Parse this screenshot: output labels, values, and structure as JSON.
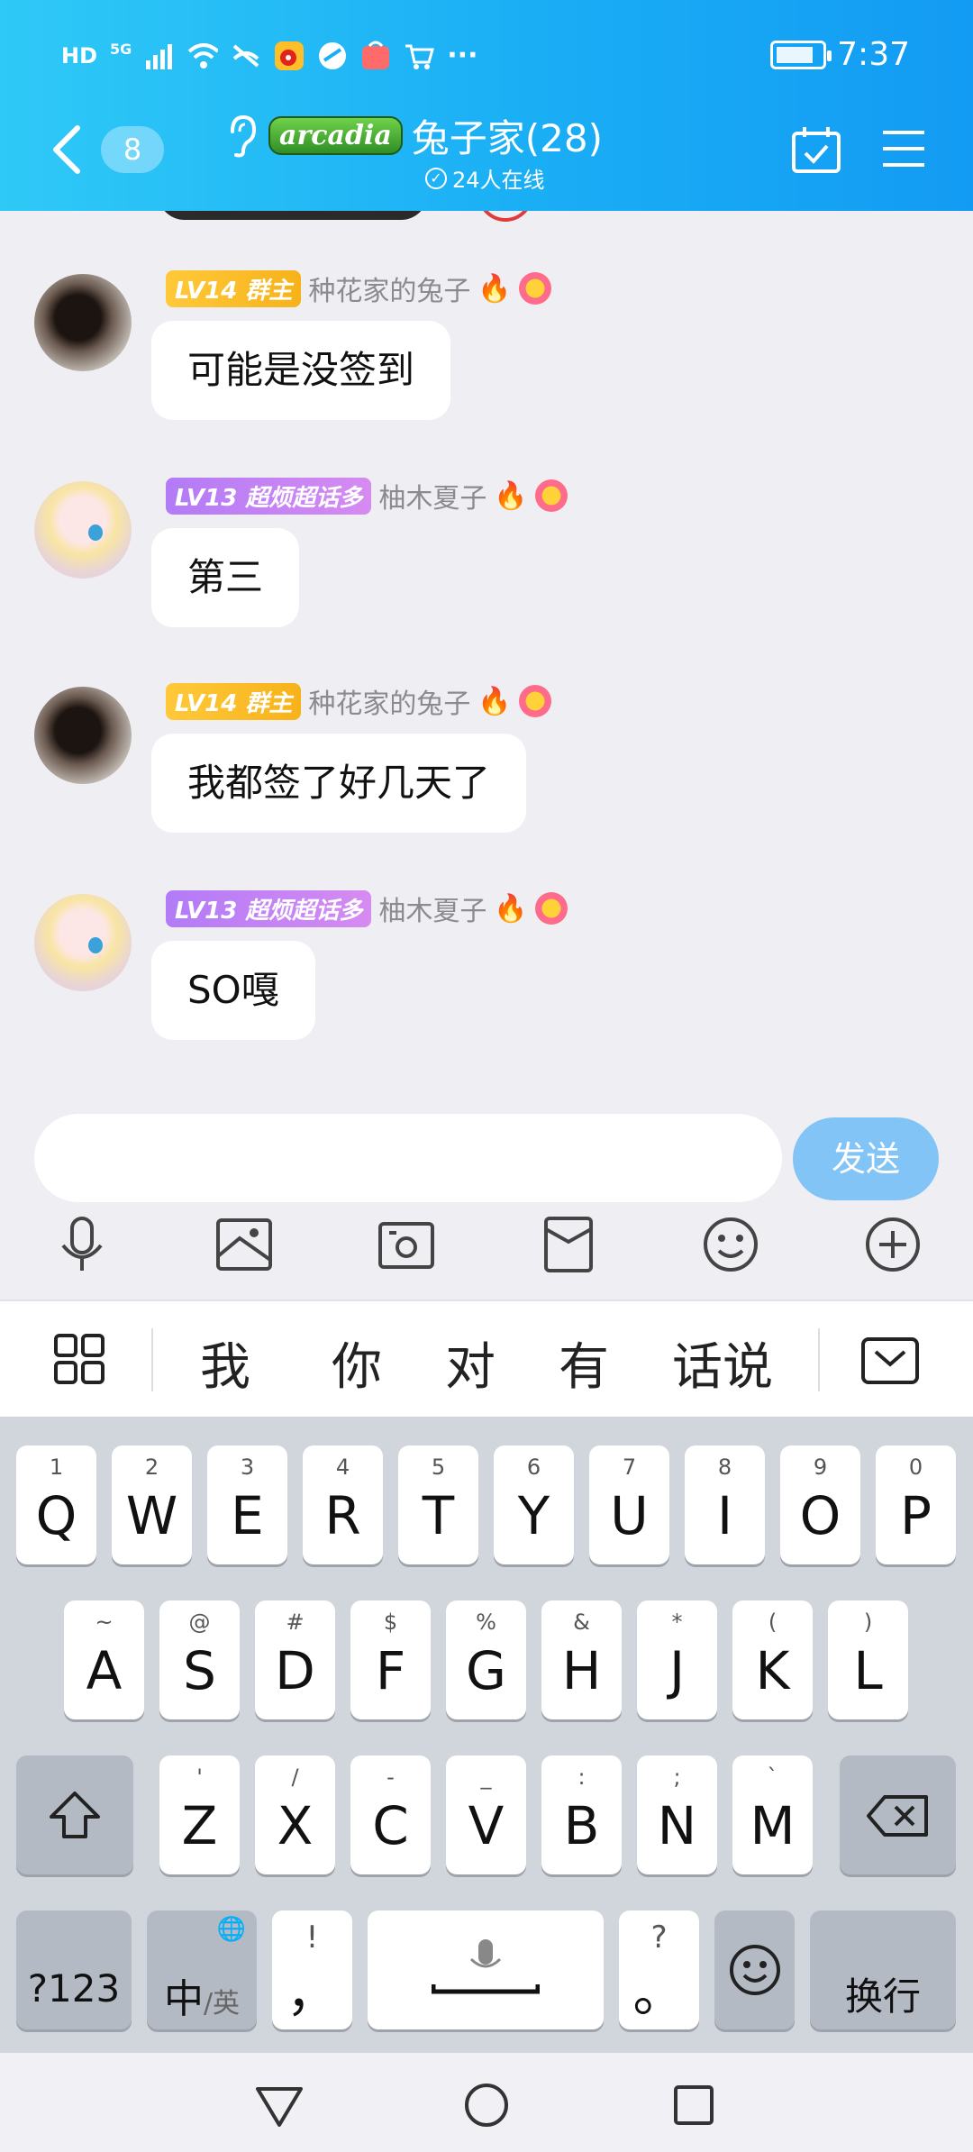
{
  "status_bar": {
    "network_labels": [
      "HD",
      "5G"
    ],
    "more": "···",
    "time": "7:37"
  },
  "header": {
    "unread_count": "8",
    "group_badge": "arcadia",
    "group_title": "兔子家(28)",
    "online": "24人在线",
    "icons": [
      "back-arrow-icon",
      "ear-icon",
      "calendar-check-icon",
      "menu-icon"
    ]
  },
  "messages": [
    {
      "level": "LV14 群主",
      "level_color": "#f7b21a",
      "nickname": "种花家的兔子",
      "text": "可能是没签到",
      "avatar": "dark-cat"
    },
    {
      "level": "LV13 超烦超话多",
      "level_color": "#c584f3",
      "nickname": "柚木夏子",
      "text": "第三",
      "avatar": "anime-girl"
    },
    {
      "level": "LV14 群主",
      "level_color": "#f7b21a",
      "nickname": "种花家的兔子",
      "text": "我都签了好几天了",
      "avatar": "dark-cat"
    },
    {
      "level": "LV13 超烦超话多",
      "level_color": "#c584f3",
      "nickname": "柚木夏子",
      "text": "SO嘎",
      "avatar": "anime-girl"
    }
  ],
  "composer": {
    "placeholder": "",
    "send_label": "发送",
    "tools": [
      "microphone-icon",
      "image-icon",
      "camera-icon",
      "file-icon",
      "emoji-icon",
      "plus-icon"
    ]
  },
  "keyboard": {
    "candidates": [
      "我",
      "你",
      "对",
      "有",
      "话说"
    ],
    "row1": [
      {
        "sup": "1",
        "key": "Q"
      },
      {
        "sup": "2",
        "key": "W"
      },
      {
        "sup": "3",
        "key": "E"
      },
      {
        "sup": "4",
        "key": "R"
      },
      {
        "sup": "5",
        "key": "T"
      },
      {
        "sup": "6",
        "key": "Y"
      },
      {
        "sup": "7",
        "key": "U"
      },
      {
        "sup": "8",
        "key": "I"
      },
      {
        "sup": "9",
        "key": "O"
      },
      {
        "sup": "0",
        "key": "P"
      }
    ],
    "row2": [
      {
        "sup": "~",
        "key": "A"
      },
      {
        "sup": "@",
        "key": "S"
      },
      {
        "sup": "#",
        "key": "D"
      },
      {
        "sup": "$",
        "key": "F"
      },
      {
        "sup": "%",
        "key": "G"
      },
      {
        "sup": "&",
        "key": "H"
      },
      {
        "sup": "*",
        "key": "J"
      },
      {
        "sup": "(",
        "key": "K"
      },
      {
        "sup": ")",
        "key": "L"
      }
    ],
    "row3": [
      {
        "sup": "'",
        "key": "Z"
      },
      {
        "sup": "/",
        "key": "X"
      },
      {
        "sup": "-",
        "key": "C"
      },
      {
        "sup": "_",
        "key": "V"
      },
      {
        "sup": ":",
        "key": "B"
      },
      {
        "sup": ";",
        "key": "N"
      },
      {
        "sup": "`",
        "key": "M"
      }
    ],
    "symbols_label": "?123",
    "lang_main": "中",
    "lang_alt": "/英",
    "comma_sup": "!",
    "comma": "，",
    "period_sup": "?",
    "period": "。",
    "enter_label": "换行"
  }
}
